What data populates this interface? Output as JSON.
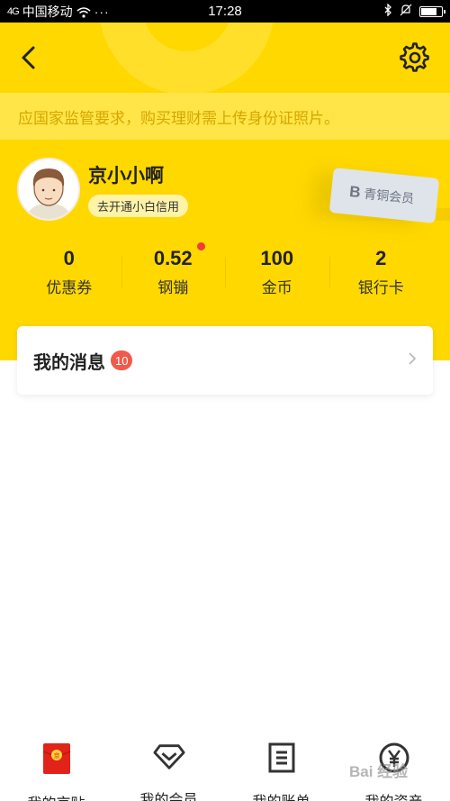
{
  "status_bar": {
    "signal": "4G",
    "carrier": "中国移动",
    "dots": "···",
    "time": "17:28"
  },
  "header": {
    "notice": "应国家监管要求，购买理财需上传身份证照片。"
  },
  "profile": {
    "name": "京小小啊",
    "credit_button": "去开通小白信用",
    "member_card_label": "青铜会员",
    "member_card_letter": "B"
  },
  "stats": [
    {
      "value": "0",
      "label": "优惠券"
    },
    {
      "value": "0.52",
      "label": "钢镚"
    },
    {
      "value": "100",
      "label": "金币"
    },
    {
      "value": "2",
      "label": "银行卡"
    }
  ],
  "messages": {
    "title": "我的消息",
    "badge": "10"
  },
  "bottom_nav": [
    {
      "label": "我的京贴",
      "icon": "red-envelope-icon"
    },
    {
      "label": "我的会员",
      "icon": "diamond-icon"
    },
    {
      "label": "我的账单",
      "icon": "bill-icon"
    },
    {
      "label": "我的资产",
      "icon": "yen-coin-icon"
    }
  ],
  "watermark": "Bai 经验",
  "colors": {
    "header_yellow": "#ffd800",
    "notice_text": "#d6a700",
    "badge_red": "#f15a4a"
  }
}
